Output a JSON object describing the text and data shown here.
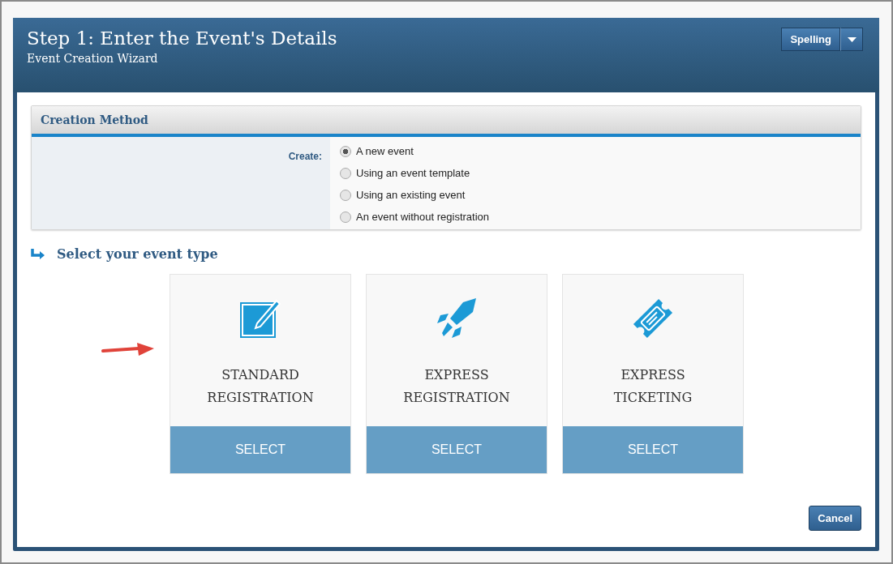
{
  "header": {
    "title": "Step 1: Enter the Event's Details",
    "subtitle": "Event Creation Wizard",
    "spelling_button": "Spelling"
  },
  "creation_method": {
    "title": "Creation Method",
    "label": "Create:",
    "options": [
      {
        "label": "A new event",
        "selected": true
      },
      {
        "label": "Using an event template",
        "selected": false
      },
      {
        "label": "Using an existing event",
        "selected": false
      },
      {
        "label": "An event without registration",
        "selected": false
      }
    ]
  },
  "event_type": {
    "heading": "Select your event type",
    "cards": [
      {
        "kind": "edit",
        "title_lines": [
          "STANDARD",
          "REGISTRATION"
        ],
        "button": "SELECT"
      },
      {
        "kind": "rocket",
        "title_lines": [
          "EXPRESS",
          "REGISTRATION"
        ],
        "button": "SELECT"
      },
      {
        "kind": "ticket",
        "title_lines": [
          "EXPRESS",
          "TICKETING"
        ],
        "button": "SELECT"
      }
    ]
  },
  "cancel_button": "Cancel"
}
